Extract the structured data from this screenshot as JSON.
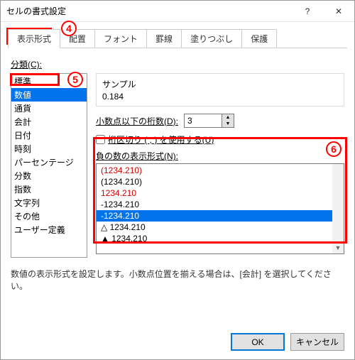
{
  "window": {
    "title": "セルの書式設定",
    "help_icon": "?",
    "close_icon": "✕"
  },
  "tabs": [
    {
      "label": "表示形式",
      "active": true
    },
    {
      "label": "配置"
    },
    {
      "label": "フォント"
    },
    {
      "label": "罫線"
    },
    {
      "label": "塗りつぶし"
    },
    {
      "label": "保護"
    }
  ],
  "category": {
    "label": "分類(C):",
    "items": [
      "標準",
      "数値",
      "通貨",
      "会計",
      "日付",
      "時刻",
      "パーセンテージ",
      "分数",
      "指数",
      "文字列",
      "その他",
      "ユーザー定義"
    ],
    "selected_index": 1
  },
  "sample": {
    "label": "サンプル",
    "value": "0.184"
  },
  "decimal": {
    "label": "小数点以下の桁数(D):",
    "value": "3"
  },
  "separator": {
    "label": "桁区切り ( , ) を使用する(U)",
    "checked": false
  },
  "negative": {
    "label": "負の数の表示形式(N):",
    "items": [
      {
        "text": "(1234.210)",
        "cls": "red"
      },
      {
        "text": "(1234.210)",
        "cls": ""
      },
      {
        "text": "1234.210",
        "cls": "red"
      },
      {
        "text": "-1234.210",
        "cls": ""
      },
      {
        "text": "-1234.210",
        "cls": "red sel"
      },
      {
        "text": "△ 1234.210",
        "cls": ""
      },
      {
        "text": "▲ 1234.210",
        "cls": ""
      }
    ]
  },
  "help_text": "数値の表示形式を設定します。小数点位置を揃える場合は、[会計] を選択してください。",
  "buttons": {
    "ok": "OK",
    "cancel": "キャンセル"
  },
  "annotations": {
    "a4": "4",
    "a5": "5",
    "a6": "6"
  }
}
